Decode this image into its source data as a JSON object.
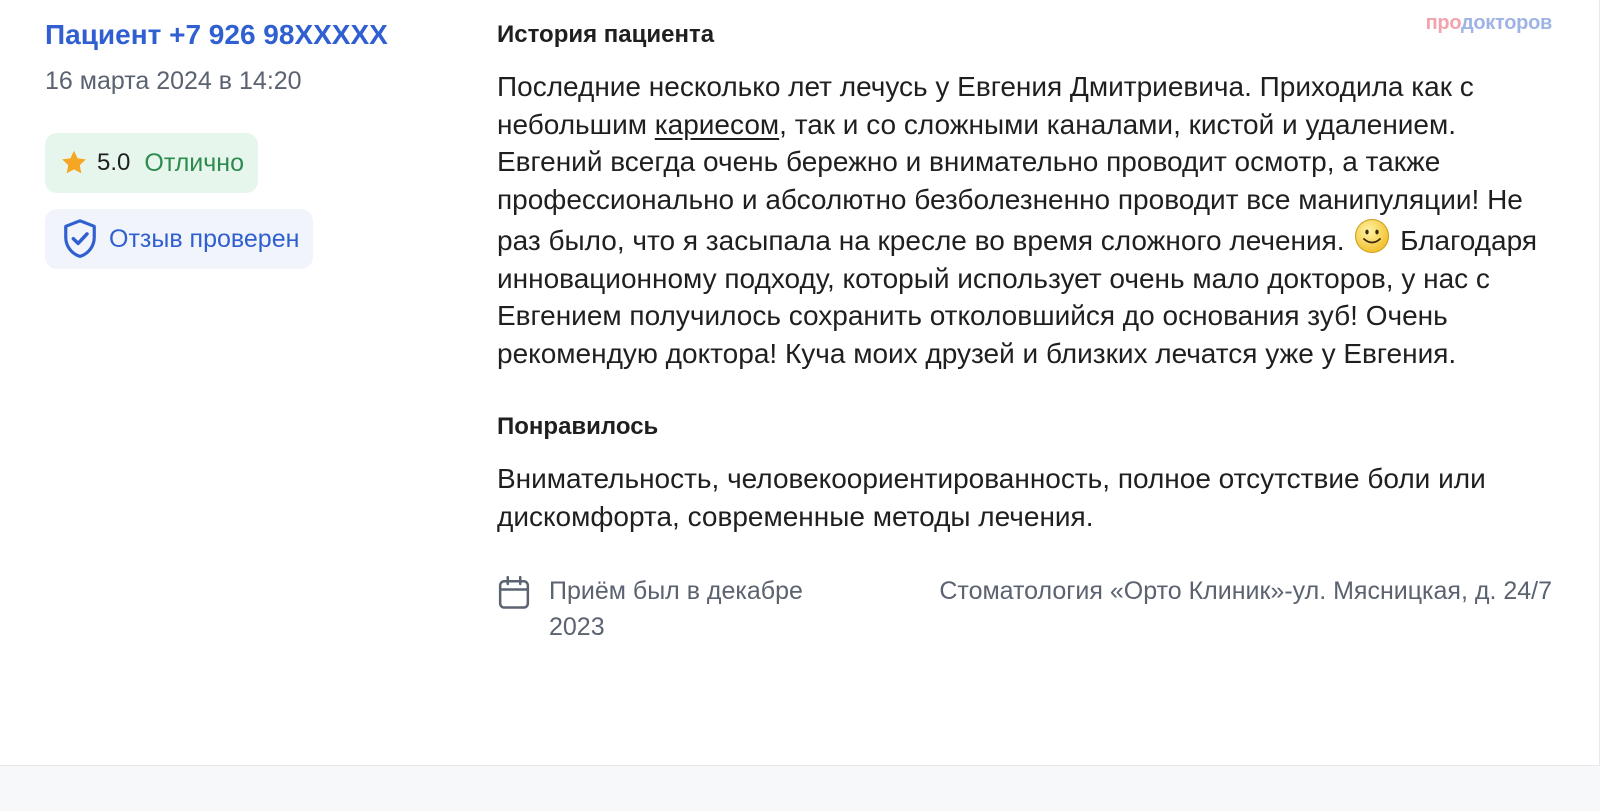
{
  "review": {
    "author": "Пациент +7 926 98XXXXX",
    "date": "16 марта 2024 в 14:20",
    "rating": {
      "score": "5.0",
      "label": "Отлично",
      "icon": "star-icon"
    },
    "verified_label": "Отзыв проверен",
    "history_title": "История пациента",
    "history_text": {
      "part1": "Последние несколько лет лечусь у Евгения Дмитриевича. Приходила как с небольшим ",
      "link": "кариесом",
      "part2": ", так и со сложными каналами, кистой и удалением. Евгений всегда очень бережно и внимательно проводит осмотр, а также профессионально и абсолютно безболезненно проводит все манипуляции! Не раз было, что я засыпала на кресле во время сложного лечения. ",
      "part3": " Благодаря инновационному подходу, который использует очень мало докторов, у нас с Евгением получилось сохранить отколовшийся до основания зуб! Очень рекомендую доктора! Куча моих друзей и близких лечатся уже у Евгения."
    },
    "liked_title": "Понравилось",
    "liked_text": "Внимательность, человекоориентированность, полное отсутствие боли или дискомфорта, современные методы лечения.",
    "visit_text": "Приём был в декабре 2023",
    "clinic": "Стоматология «Орто Клиник»-ул. Мясницкая, д. 24/7"
  },
  "brand": {
    "part1": "про",
    "part2": "докторов"
  },
  "colors": {
    "accent": "#2f5fd0",
    "rating_bg": "#e7f6ec",
    "rating_text": "#2e8b4e",
    "star": "#f5a623",
    "verified_bg": "#f1f4fb"
  }
}
